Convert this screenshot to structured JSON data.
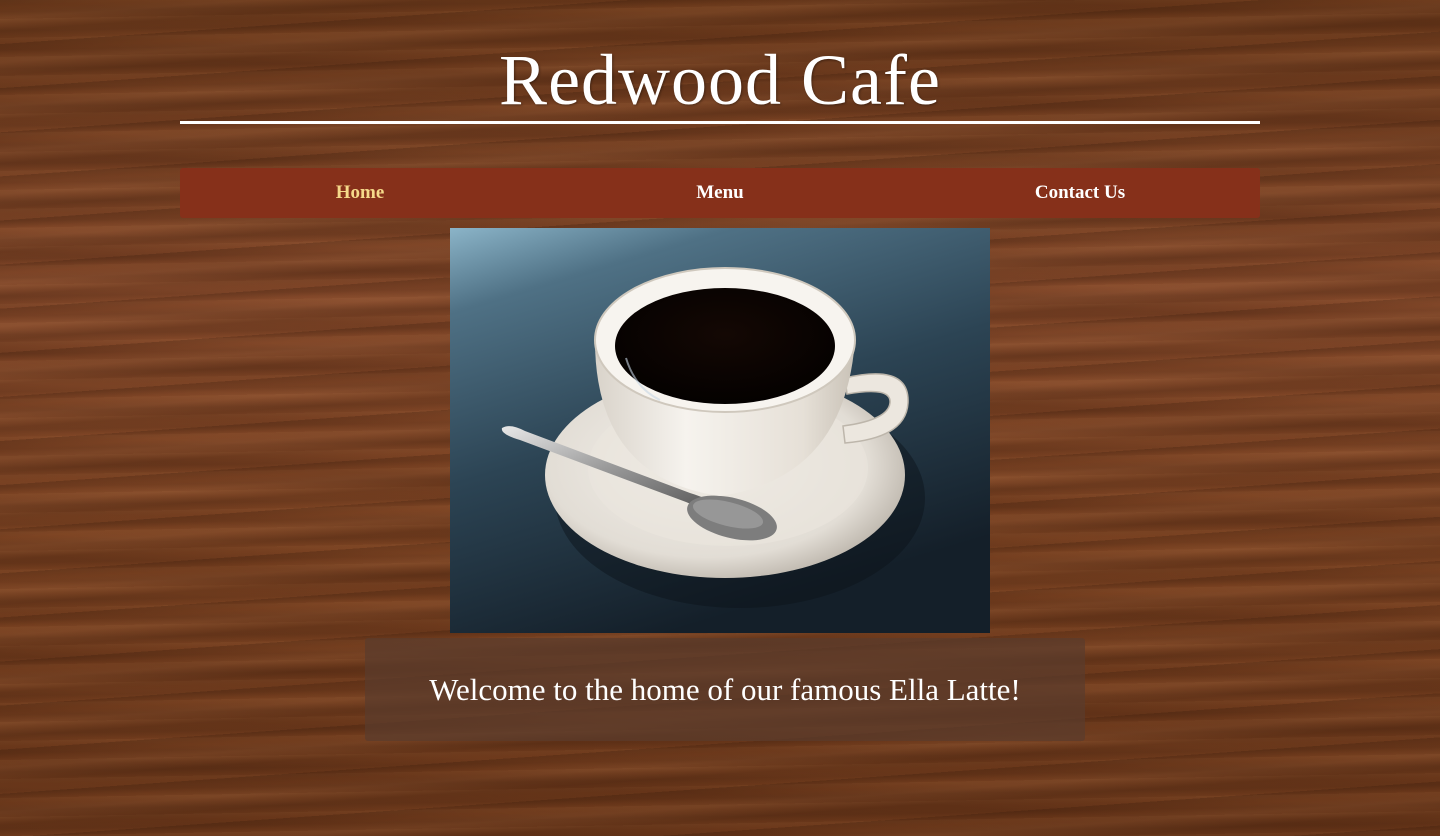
{
  "header": {
    "title": "Redwood Cafe"
  },
  "nav": {
    "items": [
      {
        "label": "Home",
        "active": true
      },
      {
        "label": "Menu",
        "active": false
      },
      {
        "label": "Contact Us",
        "active": false
      }
    ]
  },
  "hero": {
    "image_name": "coffee-cup-image"
  },
  "welcome": {
    "text": "Welcome to the home of our famous Ella Latte!"
  },
  "colors": {
    "nav_background": "#86301a",
    "active_link": "#f5d98a",
    "text": "#ffffff",
    "page_background": "#7a4421"
  }
}
